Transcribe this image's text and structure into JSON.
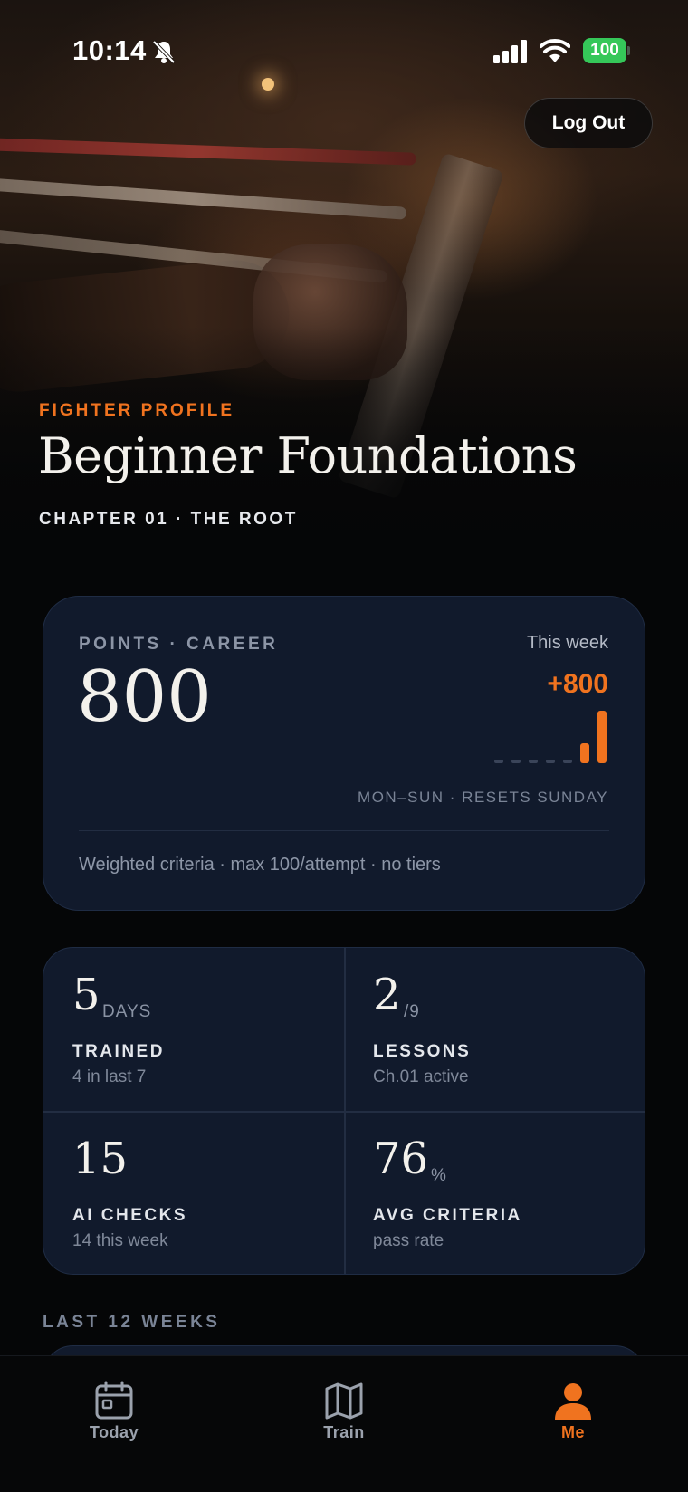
{
  "status_bar": {
    "time": "10:14",
    "battery": "100"
  },
  "header": {
    "logout_label": "Log Out"
  },
  "hero": {
    "eyebrow": "FIGHTER PROFILE",
    "title": "Beginner Foundations",
    "chapter": "CHAPTER 01 · THE ROOT"
  },
  "points_card": {
    "label": "POINTS · CAREER",
    "value": "800",
    "week_label": "This week",
    "week_delta": "+800",
    "week_note": "MON–SUN · RESETS SUNDAY",
    "footnote": "Weighted criteria · max 100/attempt · no tiers",
    "week_bars": [
      0,
      0,
      0,
      0,
      0,
      0.38,
      1
    ]
  },
  "stats": [
    {
      "value": "5",
      "unit": "DAYS",
      "title": "TRAINED",
      "sub": "4 in last 7"
    },
    {
      "value": "2",
      "unit": "/9",
      "title": "LESSONS",
      "sub": "Ch.01 active"
    },
    {
      "value": "15",
      "unit": "",
      "title": "AI CHECKS",
      "sub": "14 this week"
    },
    {
      "value": "76",
      "unit": "%",
      "title": "AVG CRITERIA",
      "sub": "pass rate"
    }
  ],
  "section": {
    "last_weeks_label": "LAST 12 WEEKS"
  },
  "tabs": [
    {
      "label": "Today",
      "icon": "calendar-icon",
      "active": false
    },
    {
      "label": "Train",
      "icon": "map-icon",
      "active": false
    },
    {
      "label": "Me",
      "icon": "person-icon",
      "active": true
    }
  ],
  "colors": {
    "accent": "#f0731f",
    "card": "#111a2c",
    "background": "#050607",
    "battery": "#35c759"
  }
}
